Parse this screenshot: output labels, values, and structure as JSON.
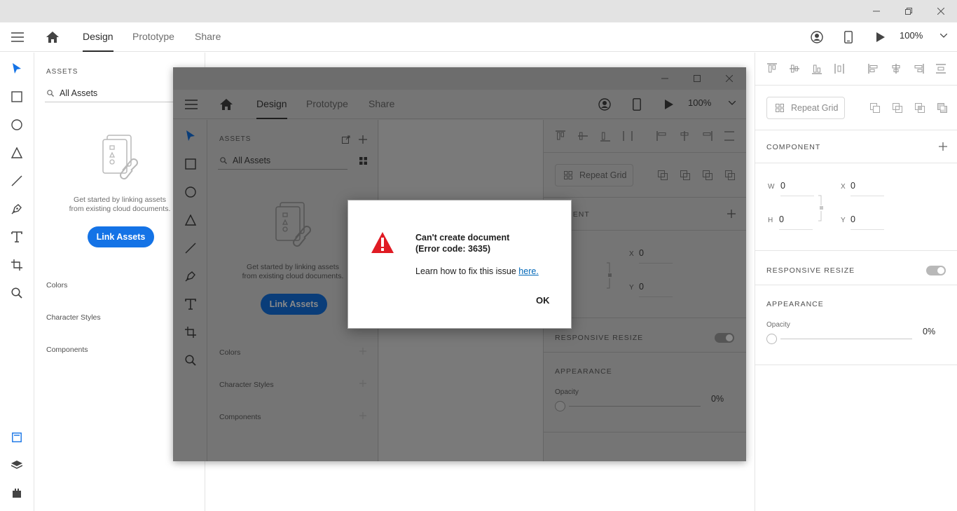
{
  "toolbar": {
    "tabs": [
      "Design",
      "Prototype",
      "Share"
    ],
    "zoom": "100%"
  },
  "assets": {
    "title": "ASSETS",
    "search_value": "All Assets",
    "empty_line1": "Get started by linking assets",
    "empty_line2": "from existing cloud documents.",
    "link_button": "Link Assets",
    "sections": [
      "Colors",
      "Character Styles",
      "Components"
    ]
  },
  "props": {
    "repeat_grid": "Repeat Grid",
    "component_title": "COMPONENT",
    "w_label": "W",
    "w_value": "0",
    "h_label": "H",
    "h_value": "0",
    "x_label": "X",
    "x_value": "0",
    "y_label": "Y",
    "y_value": "0",
    "responsive_title": "RESPONSIVE RESIZE",
    "appearance_title": "APPEARANCE",
    "opacity_label": "Opacity",
    "opacity_value": "0%"
  },
  "inner": {
    "props_component_title": "PONENT"
  },
  "dialog": {
    "title_line1": "Can't create document",
    "title_line2": "(Error code: 3635)",
    "message": "Learn how to fix this issue ",
    "link": "here.",
    "ok": "OK"
  },
  "colors": {
    "accent": "#1473e6",
    "warning": "#e01b24",
    "link": "#0067b8"
  }
}
